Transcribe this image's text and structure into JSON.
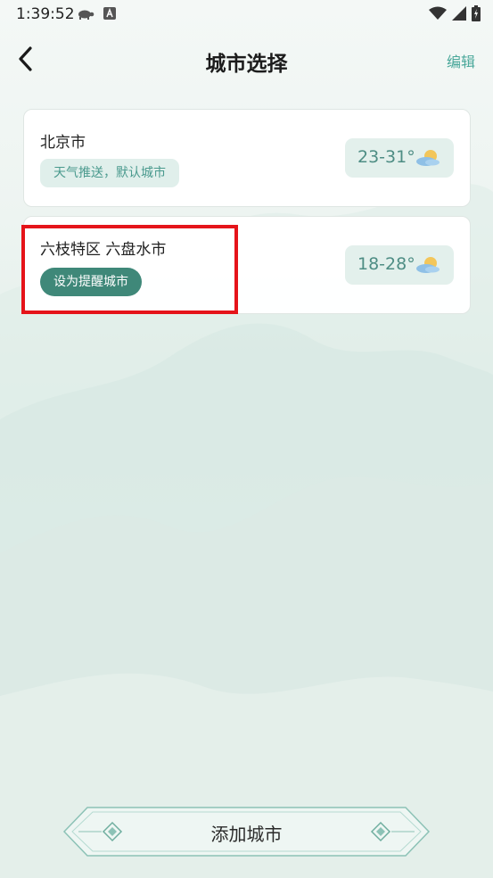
{
  "status_bar": {
    "time": "1:39:52",
    "left_icons": [
      "turtle-icon",
      "a-box-icon"
    ],
    "right_icons": [
      "wifi-icon",
      "signal-icon",
      "battery-icon"
    ]
  },
  "header": {
    "title": "城市选择",
    "edit_label": "编辑",
    "back_icon": "chevron-left-icon"
  },
  "cities": [
    {
      "name": "北京市",
      "tag_label": "天气推送，默认城市",
      "temp_range": "23-31°",
      "weather_icon": "partly-cloudy-icon"
    },
    {
      "name": "六枝特区 六盘水市",
      "action_label": "设为提醒城市",
      "temp_range": "18-28°",
      "weather_icon": "partly-cloudy-icon",
      "highlighted": true
    }
  ],
  "footer": {
    "add_city_label": "添加城市"
  },
  "colors": {
    "accent": "#4aa89a",
    "primary_button": "#3f8879",
    "highlight": "#e5141a"
  }
}
